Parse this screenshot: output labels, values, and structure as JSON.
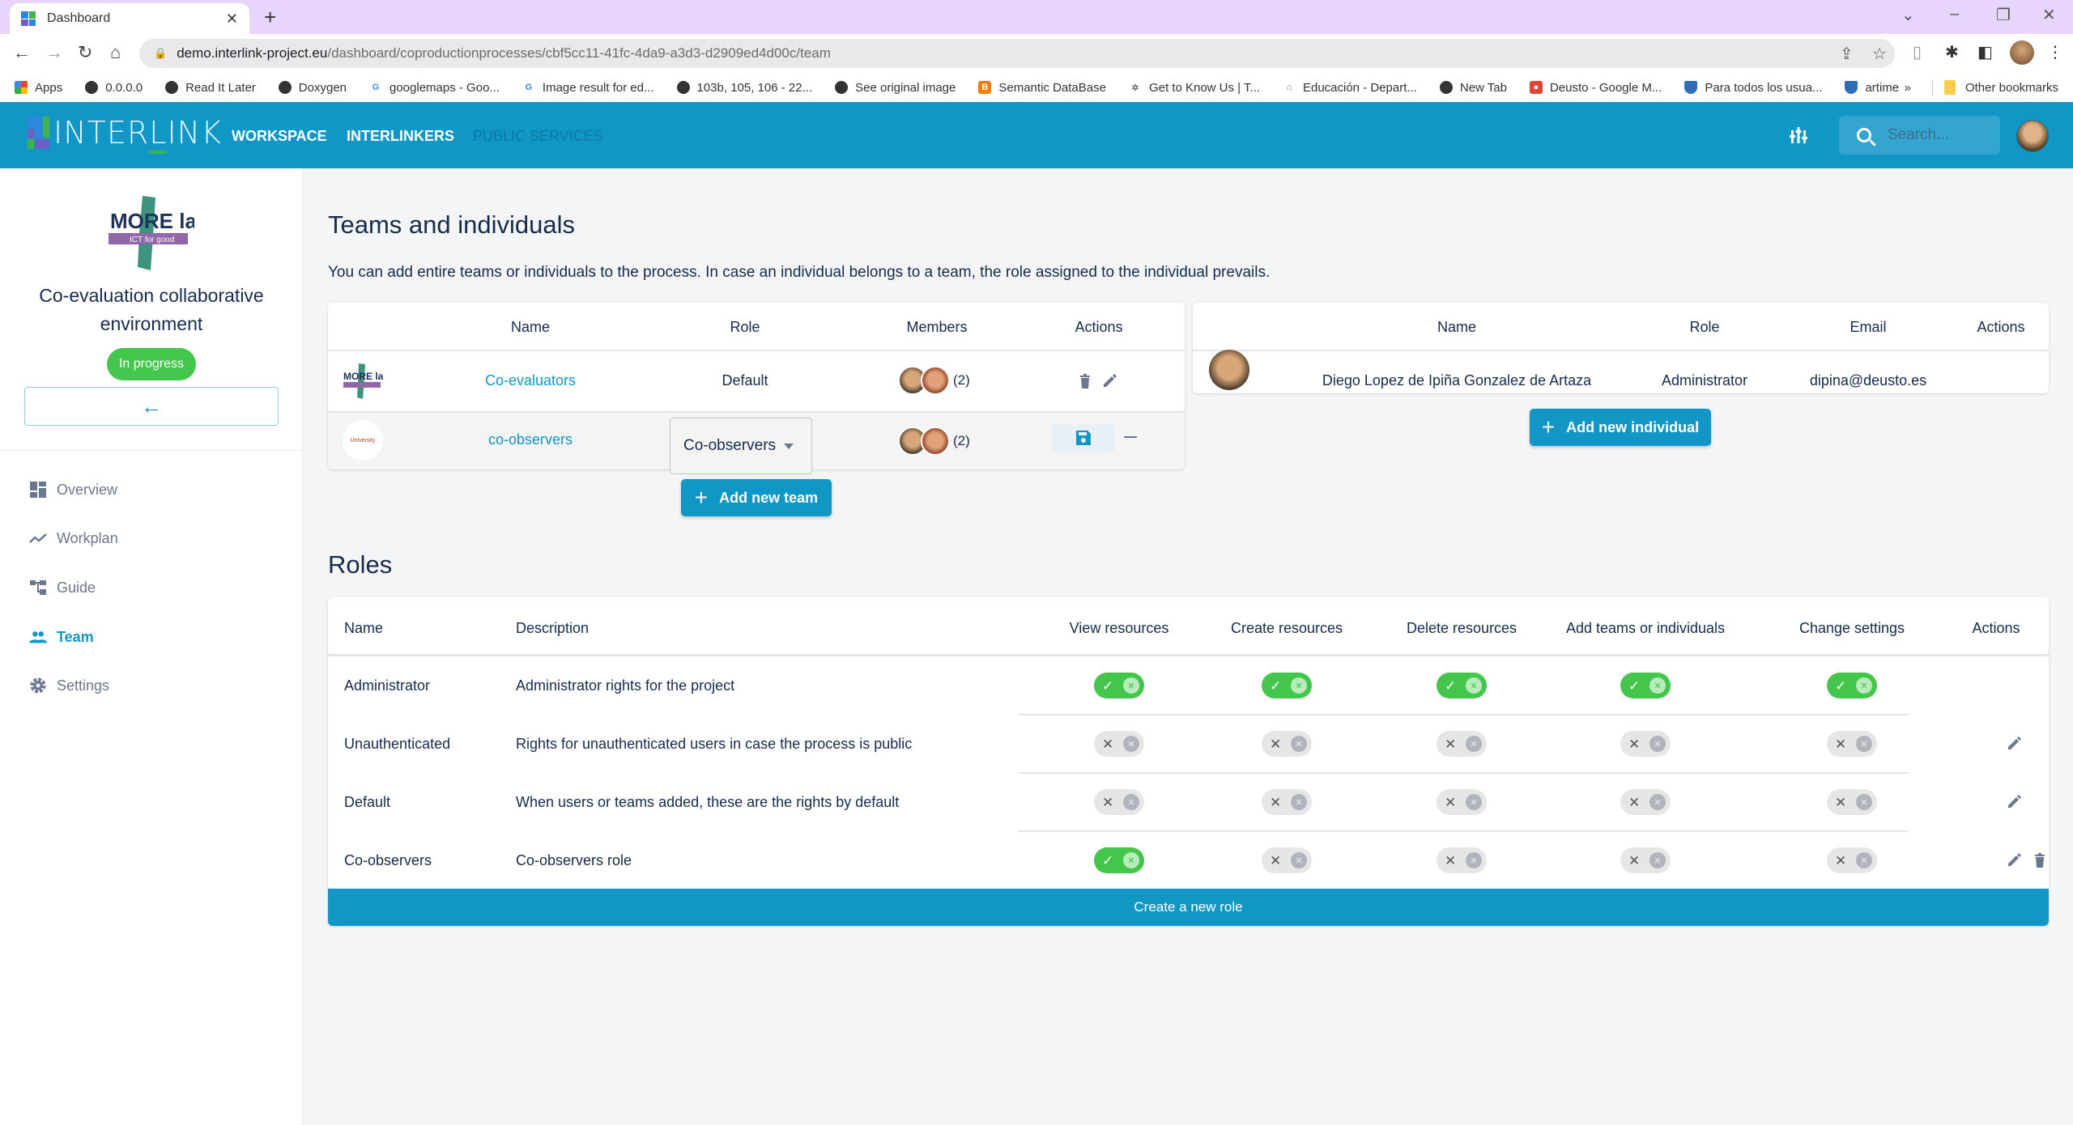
{
  "browser": {
    "tab_title": "Dashboard",
    "url_host": "demo.interlink-project.eu",
    "url_path": "/dashboard/coproductionprocesses/cbf5cc11-41fc-4da9-a3d3-d2909ed4d00c/team",
    "bookmarks": [
      {
        "label": "Apps",
        "icon": "apps-grid-icon"
      },
      {
        "label": "0.0.0.0",
        "icon": "globe-icon"
      },
      {
        "label": "Read It Later",
        "icon": "globe-icon"
      },
      {
        "label": "Doxygen",
        "icon": "globe-icon"
      },
      {
        "label": "googlemaps - Goo...",
        "icon": "google-icon"
      },
      {
        "label": "Image result for ed...",
        "icon": "google-icon"
      },
      {
        "label": "103b, 105, 106 - 22...",
        "icon": "globe-icon"
      },
      {
        "label": "See original image",
        "icon": "globe-icon"
      },
      {
        "label": "Semantic DataBase",
        "icon": "blogger-icon"
      },
      {
        "label": "Get to Know Us | T...",
        "icon": "site-icon"
      },
      {
        "label": "Educación - Depart...",
        "icon": "site-icon"
      },
      {
        "label": "New Tab",
        "icon": "globe-icon"
      },
      {
        "label": "Deusto - Google M...",
        "icon": "maps-pin-icon"
      },
      {
        "label": "Para todos los usua...",
        "icon": "deusto-icon"
      },
      {
        "label": "artime",
        "icon": "deusto-icon"
      }
    ],
    "overflow_label": "»",
    "other_bookmarks": "Other bookmarks"
  },
  "appbar": {
    "logo_text_pre": "INTER",
    "logo_text_l": "L",
    "logo_text_post": "INK",
    "nav": [
      {
        "label": "WORKSPACE",
        "active": true
      },
      {
        "label": "INTERLINKERS",
        "active": true
      },
      {
        "label": "PUBLIC SERVICES",
        "active": false
      }
    ],
    "search_placeholder": "Search..."
  },
  "sidebar": {
    "logo_top": "MORE lab",
    "logo_sub": "ICT for good",
    "project_title": "Co-evaluation collaborative environment",
    "status": "In progress",
    "status_color": "#43c64b",
    "nav": [
      {
        "label": "Overview",
        "icon": "dashboard-icon",
        "active": false
      },
      {
        "label": "Workplan",
        "icon": "timeline-icon",
        "active": false
      },
      {
        "label": "Guide",
        "icon": "account-tree-icon",
        "active": false
      },
      {
        "label": "Team",
        "icon": "people-icon",
        "active": true
      },
      {
        "label": "Settings",
        "icon": "gear-icon",
        "active": false
      }
    ]
  },
  "teams_section": {
    "title": "Teams and individuals",
    "description": "You can add entire teams or individuals to the process. In case an individual belongs to a team, the role assigned to the individual prevails.",
    "teams_table": {
      "headers": [
        "Name",
        "Role",
        "Members",
        "Actions"
      ],
      "rows": [
        {
          "name": "Co-evaluators",
          "role": "Default",
          "members_count": "(2)",
          "editing": false,
          "logo": "MORE lab"
        },
        {
          "name": "co-observers",
          "role": "Co-observers",
          "members_count": "(2)",
          "editing": true,
          "logo": "University"
        }
      ]
    },
    "add_team_label": "Add new team",
    "individuals_table": {
      "headers": [
        "Name",
        "Role",
        "Email",
        "Actions"
      ],
      "rows": [
        {
          "name": "Diego Lopez de Ipiña Gonzalez de Artaza",
          "role": "Administrator",
          "email": "dipina@deusto.es"
        }
      ]
    },
    "add_individual_label": "Add new individual"
  },
  "roles_section": {
    "title": "Roles",
    "headers": [
      "Name",
      "Description",
      "View resources",
      "Create resources",
      "Delete resources",
      "Add teams or individuals",
      "Change settings",
      "Actions"
    ],
    "rows": [
      {
        "name": "Administrator",
        "description": "Administrator rights for the project",
        "perms": [
          true,
          true,
          true,
          true,
          true
        ],
        "actions": []
      },
      {
        "name": "Unauthenticated",
        "description": "Rights for unauthenticated users in case the process is public",
        "perms": [
          false,
          false,
          false,
          false,
          false
        ],
        "actions": [
          "edit"
        ]
      },
      {
        "name": "Default",
        "description": "When users or teams added, these are the rights by default",
        "perms": [
          false,
          false,
          false,
          false,
          false
        ],
        "actions": [
          "edit"
        ]
      },
      {
        "name": "Co-observers",
        "description": "Co-observers role",
        "perms": [
          true,
          false,
          false,
          false,
          false
        ],
        "actions": [
          "edit",
          "delete"
        ]
      }
    ],
    "toggle_on_glyph": "✓",
    "toggle_off_glyph": "✕",
    "create_role_label": "Create a new role"
  },
  "colors": {
    "brand": "#1097c6",
    "success": "#43c64b",
    "text": "#172b4d",
    "muted": "#6b778c"
  }
}
